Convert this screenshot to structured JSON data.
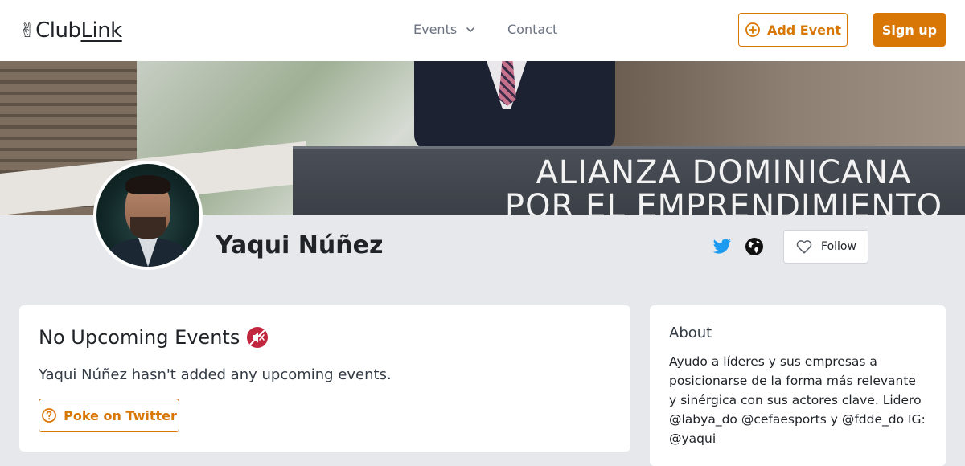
{
  "nav": {
    "logo_hand": "✌",
    "logo_prefix": "Club",
    "logo_suffix": "Link",
    "events_label": "Events",
    "contact_label": "Contact",
    "add_event_label": "Add Event",
    "signup_label": "Sign up"
  },
  "banner": {
    "line1": "ALIANZA DOMINICANA",
    "line2": "POR EL EMPRENDIMIENTO"
  },
  "profile": {
    "name": "Yaqui Núñez",
    "follow_label": "Follow"
  },
  "events_card": {
    "title": "No Upcoming Events",
    "title_emoji_icon": "muted-speaker-icon",
    "message": "Yaqui Núñez hasn't added any upcoming events.",
    "poke_label": "Poke on Twitter"
  },
  "about_card": {
    "title": "About",
    "text": "Ayudo a líderes y sus empresas a posicionarse de la forma más relevante y sinérgica con sus actores clave. Lidero @labya_do @cefaesports y @fdde_do IG: @yaqui"
  },
  "colors": {
    "accent": "#d97706",
    "twitter": "#1d9bf0",
    "page_bg": "#e6e8ec"
  }
}
